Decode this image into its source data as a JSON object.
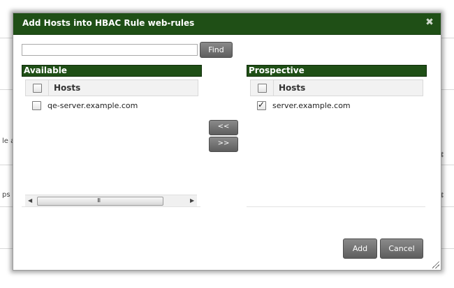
{
  "background": {
    "left_fragments": [
      "le a",
      "ps"
    ]
  },
  "dialog": {
    "title": "Add Hosts into HBAC Rule web-rules",
    "close_glyph": "✖",
    "filter": {
      "value": "",
      "placeholder": ""
    },
    "find_label": "Find",
    "available": {
      "header": "Available",
      "column": "Hosts",
      "rows": [
        {
          "host": "qe-server.example.com",
          "checked": false
        }
      ],
      "scrollbar_grip": "III"
    },
    "prospective": {
      "header": "Prospective",
      "column": "Hosts",
      "rows": [
        {
          "host": "server.example.com",
          "checked": true
        }
      ]
    },
    "move_left_label": "<<",
    "move_right_label": ">>",
    "add_label": "Add",
    "cancel_label": "Cancel"
  },
  "colors": {
    "titlebar": "#1f4f16",
    "panel_header": "#1f4f16",
    "button": "#6e6e6e"
  }
}
